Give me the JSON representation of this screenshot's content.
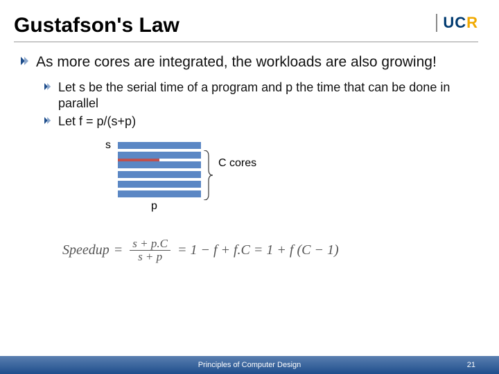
{
  "title": "Gustafson's Law",
  "logo": {
    "u": "U",
    "c": "C",
    "r": "R"
  },
  "bullets": {
    "main": "As more cores are integrated, the workloads are also growing!",
    "sub1": "Let s be the serial time of a program and p the time that can be done in parallel",
    "sub2": "Let f = p/(s+p)"
  },
  "diagram": {
    "s_label": "s",
    "p_label": "p",
    "c_label": "C cores"
  },
  "formula": {
    "lhs": "Speedup",
    "eq": "=",
    "num": "s + p.C",
    "den": "s + p",
    "rhs1": "= 1 − f + f.C = 1 + f (C − 1)"
  },
  "footer": "Principles of Computer Design",
  "page": "21"
}
